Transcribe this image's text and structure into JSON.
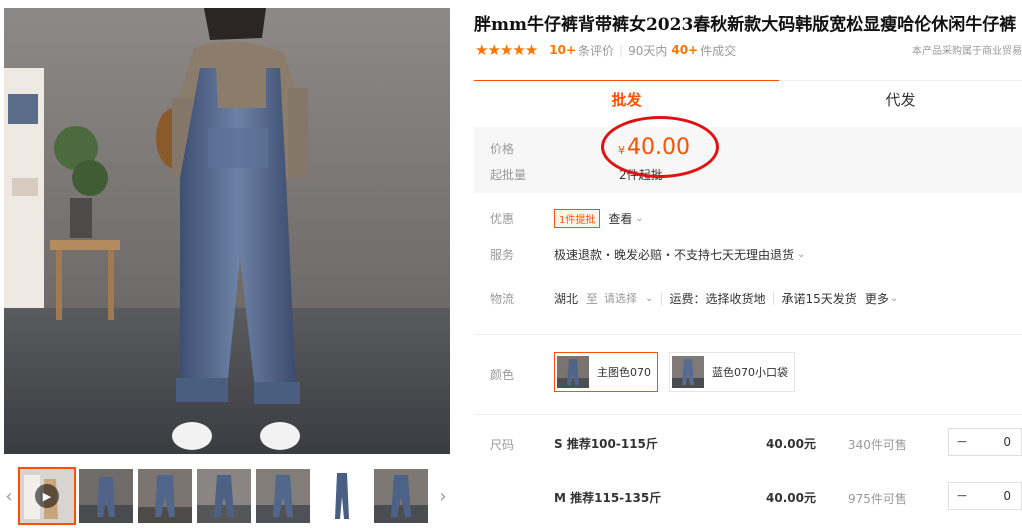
{
  "product": {
    "title": "胖mm牛仔裤背带裤女2023春秋新款大码韩版宽松显瘦哈伦休闲牛仔裤",
    "stars": "★★★★★",
    "review_count": "10+",
    "review_label": "条评价",
    "sales_period": "90天内",
    "sales_count": "40+",
    "sales_label": "件成交",
    "disclaimer": "本产品采购属于商业贸易"
  },
  "tabs": [
    {
      "label": "批发",
      "active": true
    },
    {
      "label": "代发",
      "active": false
    }
  ],
  "price": {
    "label": "价格",
    "currency": "¥",
    "amount": "40.00",
    "min_label": "起批量",
    "min_value": "2件起批"
  },
  "promo": {
    "label": "优惠",
    "tag": "1件提批",
    "link": "查看"
  },
  "service": {
    "label": "服务",
    "text": "极速退款・晚发必赔・不支持七天无理由退货"
  },
  "logistics": {
    "label": "物流",
    "from": "湖北",
    "to_label": "至",
    "to_placeholder": "请选择",
    "shipping": "运费：选择收货地",
    "promise": "承诺15天发货",
    "more": "更多"
  },
  "color": {
    "label": "颜色",
    "options": [
      {
        "label": "主图色070",
        "selected": true
      },
      {
        "label": "蓝色070小口袋",
        "selected": false
      }
    ]
  },
  "sizes": {
    "label": "尺码",
    "rows": [
      {
        "name": "S 推荐100-115斤",
        "price": "40.00元",
        "stock": "340件可售",
        "qty": "0"
      },
      {
        "name": "M 推荐115-135斤",
        "price": "40.00元",
        "stock": "975件可售",
        "qty": "0"
      }
    ]
  },
  "gallery": {
    "prev_arrow": "‹",
    "next_arrow": "›",
    "play": "▶",
    "minus": "−"
  },
  "colors": {
    "accent": "#ff5000",
    "star": "#ff7300",
    "annotation_circle": "#e41010"
  }
}
